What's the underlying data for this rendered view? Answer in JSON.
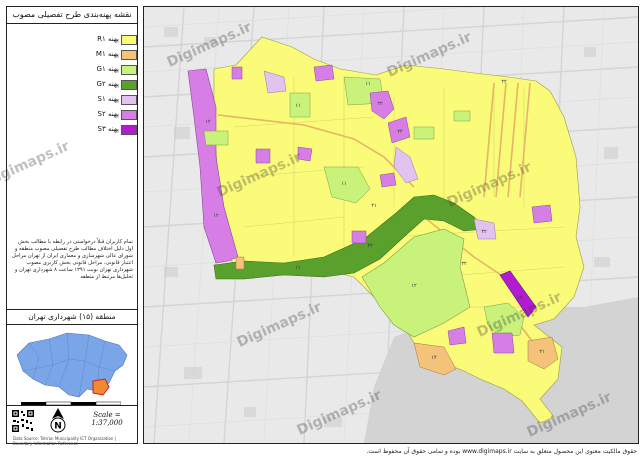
{
  "legend": {
    "title": "نقشه پهنه‌بندی طرح تفصیلی مصوب",
    "items": [
      {
        "code": "R۱",
        "label": "پهنه",
        "color": "#fbfb7a"
      },
      {
        "code": "M۱",
        "label": "پهنه",
        "color": "#f5c27a"
      },
      {
        "code": "G۱",
        "label": "پهنه",
        "color": "#c8f27a"
      },
      {
        "code": "G۲",
        "label": "پهنه",
        "color": "#5aa02c"
      },
      {
        "code": "S۱",
        "label": "پهنه",
        "color": "#e2c2ee"
      },
      {
        "code": "S۲",
        "label": "پهنه",
        "color": "#d67ee6"
      },
      {
        "code": "S۳",
        "label": "پهنه",
        "color": "#b21bd2"
      }
    ],
    "note": "تمام کاربران قبلاً درخواستی در رابطه با مطالب بخش اول دلیل اختلاف مطالب طرح تفصیلی مصوب منطقه و شورای عالی شهرسازی و معماری ایران از تهران مراحل اعتبار قانونی، مراحل قانونی بخش کاربری مصوب شهرداری تهران نوبت ۱۳۹۱ ساعت ۸ شهرداری تهران و تحلیل‌ها مرتبط از منطقه",
    "region_title": "منطقه (۱۵) شهرداری تهران",
    "scale": "Scale = 1:37,000",
    "credit": "Data Source: Tehran Municipality ICT Organization | Boundary Information Reference"
  },
  "map": {
    "watermark": "Digimaps.ir",
    "footer": "حقوق مالکیت معنوی این محصول متعلق به سایت www.digimaps.ir بوده و تمامی حقوق آن محفوظ است.",
    "zone_labels": {
      "r1": "۲۲",
      "g1": "۱۱",
      "s2": "۱۲",
      "s2b": "۱۲",
      "g2": "۱۱",
      "m1": "۱۴",
      "m1b": "۲۱",
      "s3": "۱۲",
      "r1b": "۲۲",
      "r1c": "۲۲",
      "g1b": "۱۱",
      "g1c": "۱۱",
      "g1d": "۱۲",
      "s2c": "۲۴",
      "s2d": "۲۲",
      "s1": "۲۲",
      "r1d": "۲۱"
    }
  },
  "colors": {
    "R1": "#fbfb7a",
    "M1": "#f5c27a",
    "G1": "#c8f27a",
    "G2": "#5aa02c",
    "S1": "#e2c2ee",
    "S2": "#d67ee6",
    "S3": "#b21bd2"
  }
}
